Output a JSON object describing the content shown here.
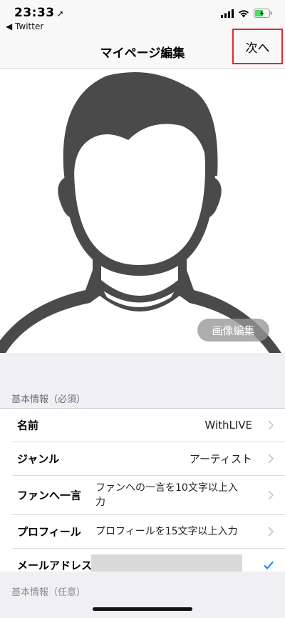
{
  "status_bar": {
    "time": "23:33",
    "back_app": "◀ Twitter"
  },
  "nav": {
    "title": "マイページ編集",
    "next_label": "次へ"
  },
  "profile": {
    "edit_image_label": "画像編集"
  },
  "section_required": {
    "header": "基本情報（必須）",
    "rows": [
      {
        "label": "名前",
        "value": "WithLIVE"
      },
      {
        "label": "ジャンル",
        "value": "アーティスト"
      },
      {
        "label": "ファンへ一言",
        "value": "ファンへの一言を10文字以上入力"
      },
      {
        "label": "プロフィール",
        "value": "プロフィールを15文字以上入力"
      },
      {
        "label": "メールアドレス",
        "value": ""
      }
    ]
  },
  "section_optional": {
    "header": "基本情報（任意）"
  },
  "colors": {
    "accent_blue": "#1a7cf0",
    "highlight_red": "#e5282a",
    "avatar_gray": "#4a4a4a"
  }
}
